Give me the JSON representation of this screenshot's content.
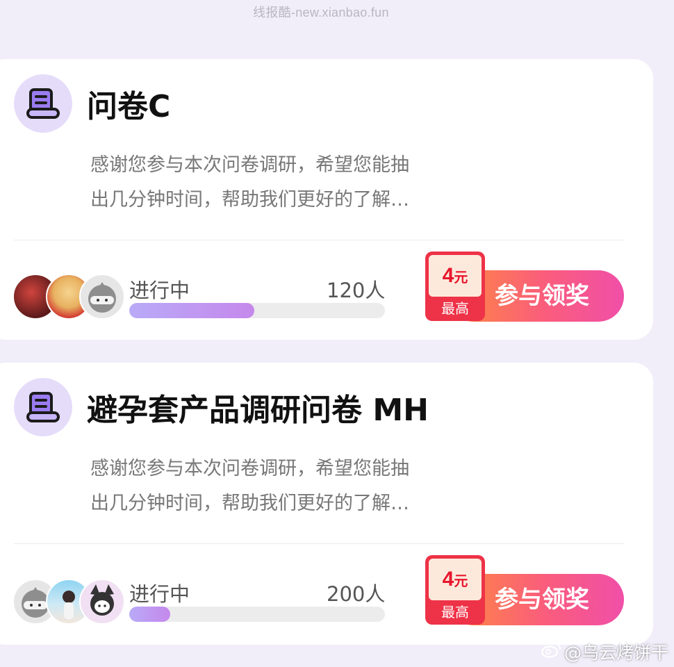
{
  "watermark": "线报酷-new.xianbao.fun",
  "weibo_watermark": "@乌云烤饼干",
  "surveys": [
    {
      "title": "问卷C",
      "description_lines": [
        "感谢您参与本次问卷调研，希望您能抽",
        "出几分钟时间，帮助我们更好的了解…"
      ],
      "status": "进行中",
      "count": "120人",
      "progress": 0.49,
      "reward_amount": "4",
      "reward_unit": "元",
      "reward_caption": "最高",
      "join_label": "参与领奖"
    },
    {
      "title": "避孕套产品调研问卷 MH",
      "description_lines": [
        "感谢您参与本次问卷调研，希望您能抽",
        "出几分钟时间，帮助我们更好的了解…"
      ],
      "status": "进行中",
      "count": "200人",
      "progress": 0.16,
      "reward_amount": "4",
      "reward_unit": "元",
      "reward_caption": "最高",
      "join_label": "参与领奖"
    }
  ],
  "colors": {
    "background": "#f1eef9",
    "progress_fill": "#c08cee",
    "button_start": "#fd8b3e",
    "button_end": "#f04fa8",
    "badge": "#ee3247"
  },
  "icons": {
    "survey": "scroll-icon",
    "weibo": "weibo-logo-icon"
  }
}
